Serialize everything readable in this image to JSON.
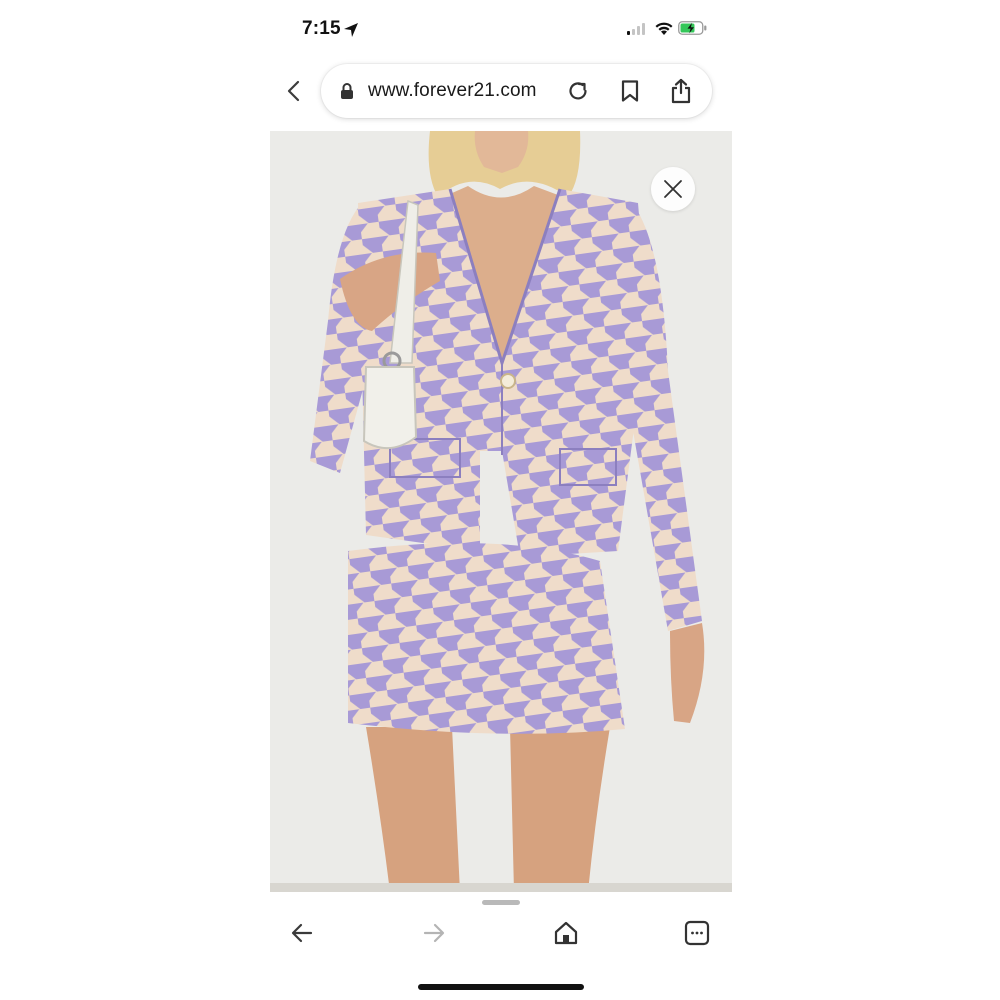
{
  "status_bar": {
    "time": "7:15",
    "signal_bars_on": 1,
    "battery_state": "charging"
  },
  "address_bar": {
    "url": "www.forever21.com"
  },
  "icons": {
    "location": "location-arrow-icon",
    "wifi": "wifi-icon",
    "battery": "battery-charging-icon",
    "back": "chevron-left-icon",
    "lock": "lock-icon",
    "reload": "reload-icon",
    "bookmark": "bookmark-icon",
    "share": "share-icon",
    "close": "close-icon",
    "nav_back": "arrow-left-icon",
    "nav_forward": "arrow-right-icon",
    "home": "home-icon",
    "tabs": "tabs-icon"
  },
  "product_image": {
    "description_colors": {
      "lavender": "#a89ad6",
      "cream": "#efdcca",
      "backdrop": "#ebebe8",
      "skin": "#d9a98a"
    }
  }
}
